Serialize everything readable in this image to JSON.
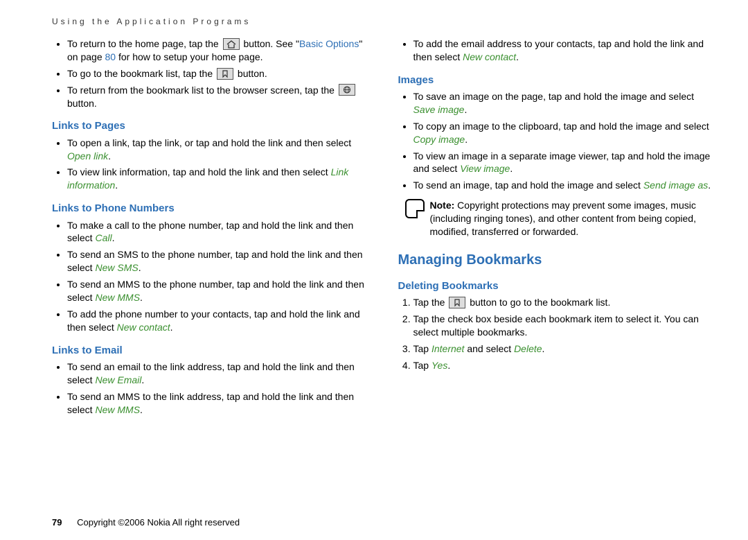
{
  "running_header": "Using the Application Programs",
  "footer": {
    "page_number": "79",
    "copyright": "Copyright ©2006 Nokia All right reserved"
  },
  "left": {
    "pre_bullets": [
      {
        "pre": "To return to the home page, tap the ",
        "icon": "home",
        "mid": " button. See \"",
        "link": "Basic Options",
        "post1": "\" on page ",
        "link2": "80",
        "post2": " for how to setup your home page."
      },
      {
        "pre": "To go to the bookmark list, tap the ",
        "icon": "bookmark",
        "post": " button."
      },
      {
        "pre": "To return from the bookmark list to the browser screen, tap the ",
        "icon": "globe",
        "post": " button."
      }
    ],
    "sect_pages": {
      "title": "Links to Pages",
      "bullets": [
        {
          "pre": "To open a link, tap the link, or tap and hold the link and then select ",
          "act": "Open link",
          "post": "."
        },
        {
          "pre": "To view link information, tap and hold the link and then select ",
          "act": "Link information",
          "post": "."
        }
      ]
    },
    "sect_phone": {
      "title": "Links to Phone Numbers",
      "bullets": [
        {
          "pre": "To make a call to the phone number, tap and hold the link and then select ",
          "act": "Call",
          "post": "."
        },
        {
          "pre": "To send an SMS to the phone number, tap and hold the link and then select ",
          "act": "New SMS",
          "post": "."
        },
        {
          "pre": "To send an MMS to the phone number, tap and hold the link and then select ",
          "act": "New MMS",
          "post": "."
        },
        {
          "pre": "To add the phone number to your contacts, tap and hold the link and then select ",
          "act": "New contact",
          "post": "."
        }
      ]
    },
    "sect_email": {
      "title": "Links to Email",
      "bullets": [
        {
          "pre": "To send an email to the link address, tap and hold the link and then select ",
          "act": "New Email",
          "post": "."
        },
        {
          "pre": "To send an MMS to the link address, tap and hold the link and then select ",
          "act": "New MMS",
          "post": "."
        }
      ]
    }
  },
  "right": {
    "pre_bullets": [
      {
        "pre": "To add the email address to your contacts, tap and hold the link and then select ",
        "act": "New contact",
        "post": "."
      }
    ],
    "sect_images": {
      "title": "Images",
      "bullets": [
        {
          "pre": "To save an image on the page, tap and hold the image and select ",
          "act": "Save image",
          "post": "."
        },
        {
          "pre": "To copy an image to the clipboard, tap and hold the image and select ",
          "act": "Copy image",
          "post": "."
        },
        {
          "pre": "To view an image in a separate image viewer, tap and hold the image and select ",
          "act": "View image",
          "post": "."
        },
        {
          "pre": "To send an image, tap and hold the image and select ",
          "act": "Send image as",
          "post": "."
        }
      ],
      "note_label": "Note:",
      "note": " Copyright protections may prevent some images, music (including ringing tones), and other content from being copied, modified, transferred or forwarded."
    },
    "sect_manage": {
      "title": "Managing Bookmarks",
      "sub_delete": {
        "title": "Deleting Bookmarks",
        "steps": [
          {
            "pre": "Tap the ",
            "icon": "bookmark",
            "post": " button to go to the bookmark list."
          },
          {
            "pre": "Tap the check box beside each bookmark item to select it. You can select multiple bookmarks."
          },
          {
            "pre": "Tap ",
            "act": "Internet",
            "mid": " and select ",
            "act2": "Delete",
            "post": "."
          },
          {
            "pre": "Tap ",
            "act": "Yes",
            "post": "."
          }
        ]
      }
    }
  }
}
